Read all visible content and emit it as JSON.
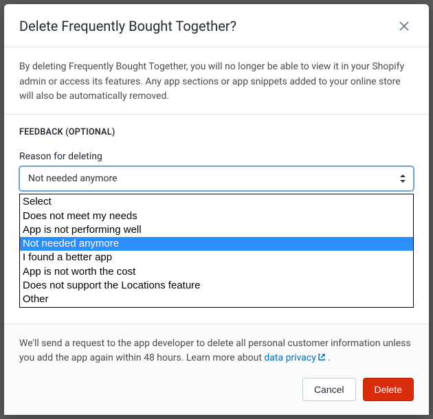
{
  "modal": {
    "title": "Delete Frequently Bought Together?",
    "description": "By deleting Frequently Bought Together, you will no longer be able to view it in your Shopify admin or access its features. Any app sections or app snippets added to your online store will also be automatically removed."
  },
  "feedback": {
    "heading": "FEEDBACK (OPTIONAL)",
    "reason_label": "Reason for deleting",
    "selected": "Not needed anymore",
    "options": [
      "Select",
      "Does not meet my needs",
      "App is not performing well",
      "Not needed anymore",
      "I found a better app",
      "App is not worth the cost",
      "Does not support the Locations feature",
      "Other"
    ]
  },
  "footer": {
    "note_prefix": "We'll send a request to the app developer to delete all personal customer information unless you add the app again within 48 hours. Learn more about ",
    "link_text": "data privacy",
    "note_suffix": " .",
    "cancel_label": "Cancel",
    "delete_label": "Delete"
  }
}
